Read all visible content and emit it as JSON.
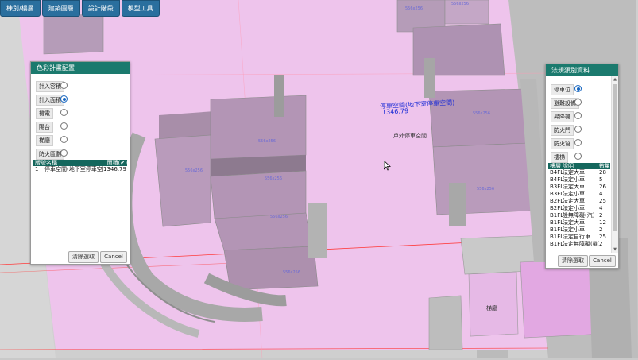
{
  "nav": [
    "棟別/樓層",
    "建築圖層",
    "設計階段",
    "模型工具"
  ],
  "left_panel": {
    "title": "色彩計畫配置",
    "options": [
      {
        "label": "計入容積",
        "checked": false
      },
      {
        "label": "計入面積",
        "checked": true
      },
      {
        "label": "機電",
        "checked": false
      },
      {
        "label": "陽台",
        "checked": false
      },
      {
        "label": "梯廳",
        "checked": false
      },
      {
        "label": "防火區劃",
        "checked": false
      }
    ],
    "table": {
      "headers": [
        "版號名稱",
        "面積(✔)"
      ],
      "rows": [
        {
          "index": "1",
          "name": "停車空間(地下室停車空間)",
          "area": "1346.79"
        }
      ]
    },
    "clear_button": "清除選取",
    "cancel_button": "Cancel"
  },
  "right_panel": {
    "title": "法規類別資料",
    "options": [
      {
        "label": "停車位",
        "checked": true
      },
      {
        "label": "避難設備",
        "checked": false
      },
      {
        "label": "昇降機",
        "checked": false
      },
      {
        "label": "防火門",
        "checked": false
      },
      {
        "label": "防火窗",
        "checked": false
      },
      {
        "label": "樓梯",
        "checked": false
      }
    ],
    "table": {
      "headers": [
        "樓層",
        "說明",
        "數量"
      ],
      "rows": [
        {
          "floor": "B4FL",
          "desc": "法定大車",
          "qty": "28"
        },
        {
          "floor": "B4FL",
          "desc": "法定小車",
          "qty": "5"
        },
        {
          "floor": "B3FL",
          "desc": "法定大車",
          "qty": "26"
        },
        {
          "floor": "B3FL",
          "desc": "法定小車",
          "qty": "4"
        },
        {
          "floor": "B2FL",
          "desc": "法定大車",
          "qty": "25"
        },
        {
          "floor": "B2FL",
          "desc": "法定小車",
          "qty": "4"
        },
        {
          "floor": "B1FL",
          "desc": "設無障礙(汽)",
          "qty": "2"
        },
        {
          "floor": "B1FL",
          "desc": "法定大車",
          "qty": "12"
        },
        {
          "floor": "B1FL",
          "desc": "法定小車",
          "qty": "2"
        },
        {
          "floor": "B1FL",
          "desc": "法定自行車",
          "qty": "25"
        },
        {
          "floor": "B1FL",
          "desc": "法定無障礙(機)",
          "qty": "2"
        }
      ]
    },
    "clear_button": "清除選取",
    "cancel_button": "Cancel"
  },
  "scene_labels": {
    "parking_label": "停車空間(地下室停車空間)",
    "parking_area": "1346.79",
    "outer_parking": "戶外停車空間",
    "stair": "梯廳",
    "spaces": [
      "556x256",
      "556x256",
      "556x256",
      "556x256",
      "556x256",
      "556x256",
      "556x256",
      "556x256",
      "556x256"
    ]
  },
  "colors": {
    "nav": "#2a6f9e",
    "panel_title": "#1b7a6e",
    "pink_area": "#eec4ec",
    "label_blue": "#1a2bd6"
  }
}
